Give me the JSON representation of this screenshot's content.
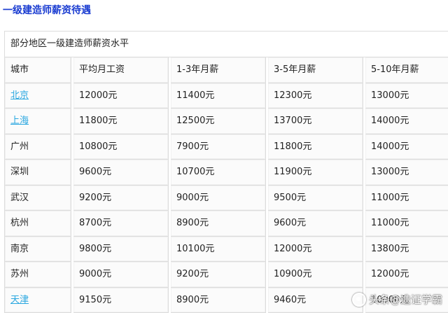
{
  "heading": "一级建造师薪资待遇",
  "table": {
    "caption": "部分地区一级建造师薪资水平",
    "headers": [
      "城市",
      "平均月工资",
      "1-3年月薪",
      "3-5年月薪",
      "5-10年月薪"
    ],
    "rows": [
      [
        "北京",
        "12000元",
        "11400元",
        "12300元",
        "13000元"
      ],
      [
        "上海",
        "11800元",
        "12500元",
        "13700元",
        "14000元"
      ],
      [
        "广州",
        "10800元",
        "7900元",
        "11800元",
        "14000元"
      ],
      [
        "深圳",
        "9600元",
        "10700元",
        "11900元",
        "13000元"
      ],
      [
        "武汉",
        "9200元",
        "9000元",
        "9500元",
        "11000元"
      ],
      [
        "杭州",
        "8700元",
        "8900元",
        "9600元",
        "11000元"
      ],
      [
        "南京",
        "9800元",
        "10100元",
        "12000元",
        "13800元"
      ],
      [
        "苏州",
        "9000元",
        "9200元",
        "10900元",
        "12000元"
      ],
      [
        "天津",
        "9150元",
        "8900元",
        "9460元",
        "10000元"
      ]
    ],
    "linked_cities": [
      "北京",
      "上海",
      "天津"
    ]
  },
  "watermark": "头条@造证学霸",
  "colors": {
    "heading": "#1a3cd1",
    "link": "#2aa7e0",
    "border": "#dcdcdc"
  }
}
